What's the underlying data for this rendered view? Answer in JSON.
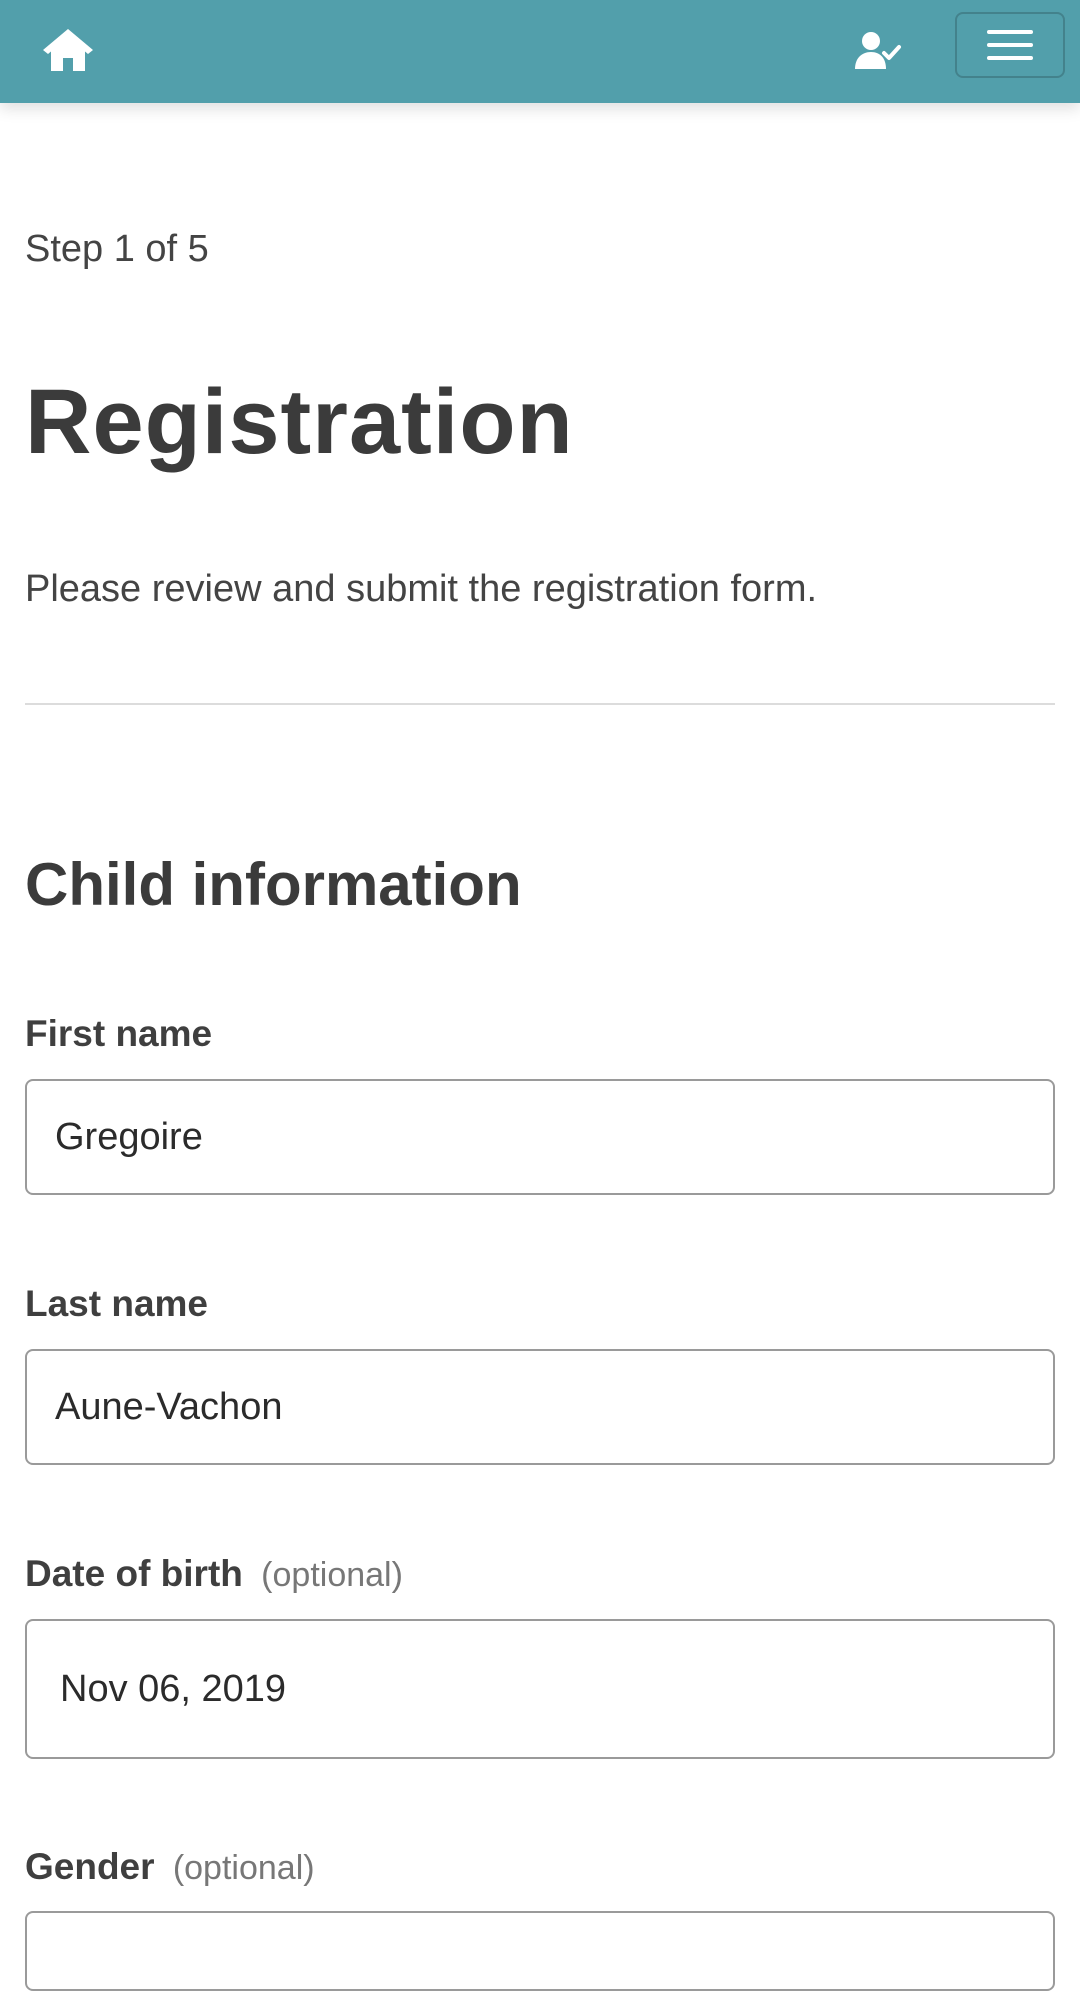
{
  "theme": {
    "brand": "#529fab",
    "icon_color": "#ffffff"
  },
  "navbar": {
    "home_icon": "home-icon",
    "user_icon": "user-check-icon",
    "menu_icon": "hamburger-menu-icon"
  },
  "page": {
    "step": "Step 1 of 5",
    "title": "Registration",
    "intro": "Please review and submit the registration form."
  },
  "child_section": {
    "title": "Child information",
    "first_name": {
      "label": "First name",
      "value": "Gregoire"
    },
    "last_name": {
      "label": "Last name",
      "value": "Aune-Vachon"
    },
    "date_of_birth": {
      "label": "Date of birth",
      "optional": "(optional)",
      "value": "Nov 06, 2019"
    },
    "gender": {
      "label": "Gender",
      "optional": "(optional)",
      "value": ""
    }
  }
}
